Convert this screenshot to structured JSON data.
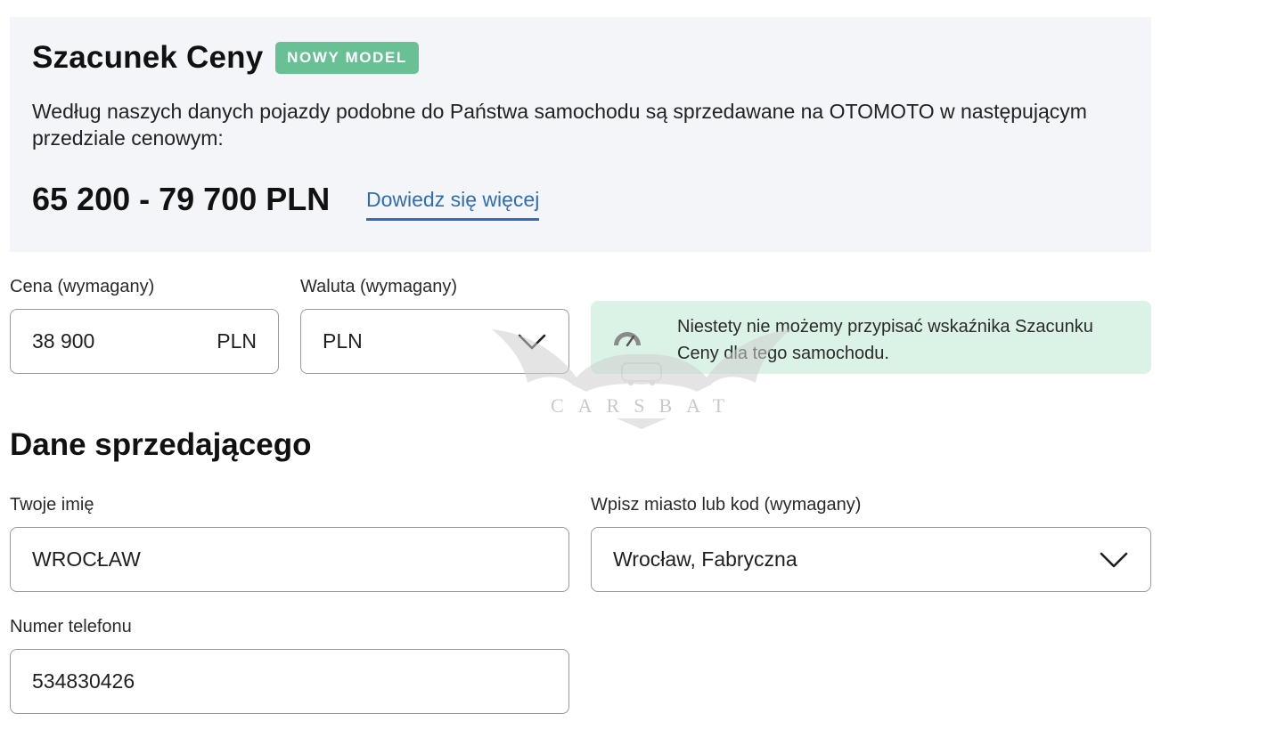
{
  "estimate": {
    "title": "Szacunek Ceny",
    "badge": "NOWY MODEL",
    "description": "Według naszych danych pojazdy podobne do Państwa samochodu są sprzedawane na OTOMOTO w następującym przedziale cenowym:",
    "price_range": "65 200 - 79 700 PLN",
    "learn_more": "Dowiedz się więcej"
  },
  "price": {
    "label": "Cena (wymagany)",
    "value": "38 900",
    "suffix": "PLN"
  },
  "currency": {
    "label": "Waluta (wymagany)",
    "value": "PLN"
  },
  "notice": {
    "text": "Niestety nie możemy przypisać wskaźnika Szacunku Ceny dla tego samochodu."
  },
  "seller": {
    "title": "Dane sprzedającego",
    "name": {
      "label": "Twoje imię",
      "value": "WROCŁAW"
    },
    "city": {
      "label": "Wpisz miasto lub kod (wymagany)",
      "value": "Wrocław, Fabryczna"
    },
    "phone": {
      "label": "Numer telefonu",
      "value": "534830426"
    }
  },
  "watermark": {
    "text": "CARSBAT"
  },
  "colors": {
    "badge": "#69c095",
    "link": "#2f6eb5",
    "notice_bg": "#dbf3e6",
    "panel_bg": "#f4f5f8"
  },
  "icons": [
    "chevron-down-icon",
    "gauge-icon"
  ]
}
